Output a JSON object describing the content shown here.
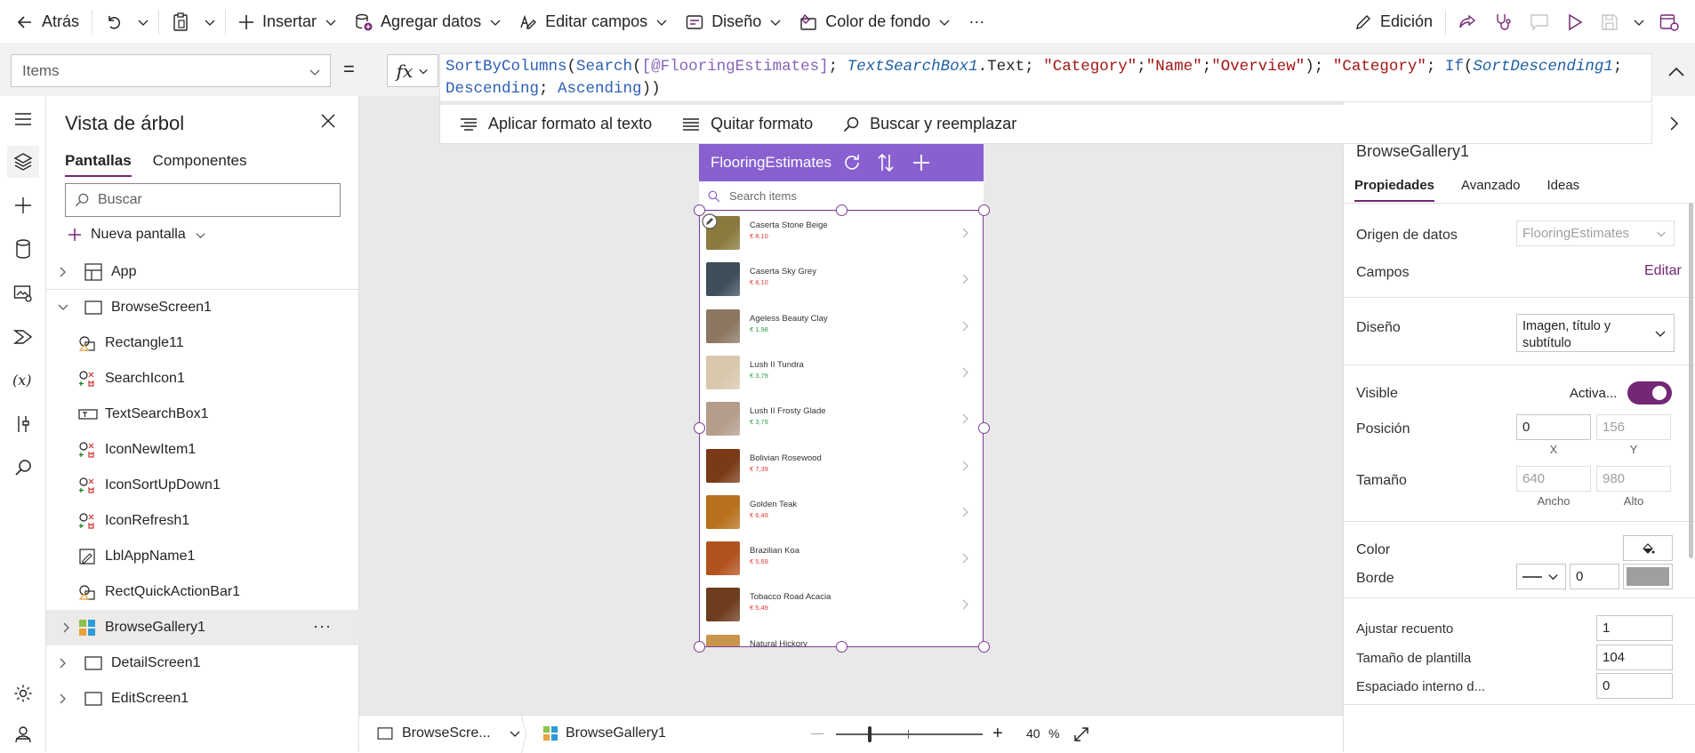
{
  "toolbar": {
    "back": "Atrás",
    "insert": "Insertar",
    "add_data": "Agregar datos",
    "edit_fields": "Editar campos",
    "design": "Diseño",
    "background_color": "Color de fondo",
    "more": "···",
    "edit_mode": "Edición"
  },
  "formula_bar": {
    "property": "Items",
    "equals": "=",
    "fx": "fx",
    "tools": {
      "format_text": "Aplicar formato al texto",
      "remove_format": "Quitar formato",
      "find_replace": "Buscar y reemplazar"
    }
  },
  "tree": {
    "title": "Vista de árbol",
    "tabs": [
      "Pantallas",
      "Componentes"
    ],
    "search_placeholder": "Buscar",
    "new_screen": "Nueva pantalla",
    "nodes": [
      {
        "label": "App",
        "icon": "app-icon"
      },
      {
        "label": "BrowseScreen1",
        "icon": "screen-icon"
      },
      {
        "label": "Rectangle11",
        "icon": "shape-icon"
      },
      {
        "label": "SearchIcon1",
        "icon": "icon-control-icon"
      },
      {
        "label": "TextSearchBox1",
        "icon": "textbox-icon"
      },
      {
        "label": "IconNewItem1",
        "icon": "icon-control-icon"
      },
      {
        "label": "IconSortUpDown1",
        "icon": "icon-control-icon"
      },
      {
        "label": "IconRefresh1",
        "icon": "icon-control-icon"
      },
      {
        "label": "LblAppName1",
        "icon": "label-icon"
      },
      {
        "label": "RectQuickActionBar1",
        "icon": "shape-icon"
      },
      {
        "label": "BrowseGallery1",
        "icon": "gallery-icon",
        "more": "···"
      },
      {
        "label": "DetailScreen1",
        "icon": "screen-icon"
      },
      {
        "label": "EditScreen1",
        "icon": "screen-icon"
      }
    ]
  },
  "app": {
    "title": "FlooringEstimates",
    "search_placeholder": "Search items",
    "items": [
      {
        "name": "Caserta Stone Beige",
        "price": "€ 8,10",
        "color": "#8a7a3e",
        "price_color": "#e03a3a"
      },
      {
        "name": "Caserta Sky Grey",
        "price": "€ 8,10",
        "color": "#3e4e5a",
        "price_color": "#e03a3a"
      },
      {
        "name": "Ageless Beauty Clay",
        "price": "€ 1,98",
        "color": "#8c7762",
        "price_color": "#2e9e4f"
      },
      {
        "name": "Lush II Tundra",
        "price": "€ 3,79",
        "color": "#d9c8ad",
        "price_color": "#2e9e4f"
      },
      {
        "name": "Lush II Frosty Glade",
        "price": "€ 3,79",
        "color": "#b49d8b",
        "price_color": "#2e9e4f"
      },
      {
        "name": "Bolivian Rosewood",
        "price": "€ 7,39",
        "color": "#7a3a18",
        "price_color": "#e03a3a"
      },
      {
        "name": "Golden Teak",
        "price": "€ 6,49",
        "color": "#b8721e",
        "price_color": "#e03a3a"
      },
      {
        "name": "Brazilian Koa",
        "price": "€ 5,69",
        "color": "#b2521e",
        "price_color": "#e03a3a"
      },
      {
        "name": "Tobacco Road Acacia",
        "price": "€ 5,49",
        "color": "#6e3c1e",
        "price_color": "#e03a3a"
      },
      {
        "name": "Natural Hickory",
        "price": "",
        "color": "#c9954c",
        "price_color": "#e03a3a"
      }
    ]
  },
  "status_bar": {
    "screen": "BrowseScre...",
    "control": "BrowseGallery1",
    "zoom_minus": "—",
    "zoom_plus": "+",
    "zoom_value": "40",
    "zoom_unit": "%",
    "zoom_level_fraction": 0.22
  },
  "properties": {
    "control_name": "BrowseGallery1",
    "tabs": [
      "Propiedades",
      "Avanzado",
      "Ideas"
    ],
    "data_source_label": "Origen de datos",
    "data_source_value": "FlooringEstimates",
    "fields_label": "Campos",
    "fields_edit": "Editar",
    "layout_label": "Diseño",
    "layout_value": "Imagen, título y subtítulo",
    "visible_label": "Visible",
    "visible_value": "Activa...",
    "position_label": "Posición",
    "position_x": "0",
    "position_y": "156",
    "x_label": "X",
    "y_label": "Y",
    "size_label": "Tamaño",
    "width": "640",
    "height": "980",
    "width_label": "Ancho",
    "height_label": "Alto",
    "color_label": "Color",
    "border_label": "Borde",
    "border_width": "0",
    "wrap_count_label": "Ajustar recuento",
    "wrap_count": "1",
    "template_size_label": "Tamaño de plantilla",
    "template_size": "104",
    "padding_label": "Espaciado interno d...",
    "padding_value": "0"
  },
  "colors": {
    "accent": "#742774",
    "app_header": "#8860d0",
    "toggle_on": "#742774"
  }
}
